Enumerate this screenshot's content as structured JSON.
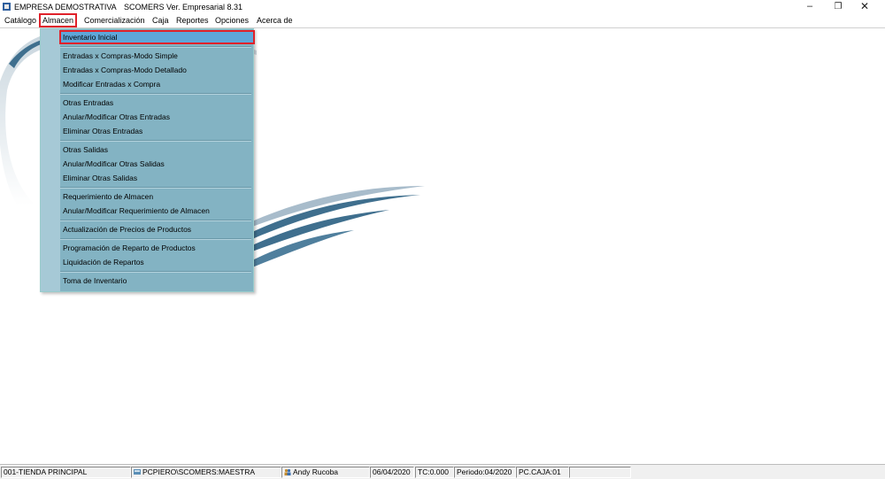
{
  "titlebar": {
    "app_name": "EMPRESA DEMOSTRATIVA",
    "version": "SCOMERS Ver. Empresarial  8.31",
    "minimize": "–",
    "restore": "❐",
    "close": "✕"
  },
  "menubar": {
    "items": [
      "Catálogo",
      "Almacen",
      "Comercialización",
      "Caja",
      "Reportes",
      "Opciones",
      "Acerca de"
    ],
    "active_item": "Almacen"
  },
  "dropdown": {
    "items": [
      "Inventario Inicial",
      "Entradas x Compras-Modo Simple",
      "Entradas x Compras-Modo Detallado",
      "Modificar Entradas x Compra",
      "Otras Entradas",
      "Anular/Modificar Otras Entradas",
      "Eliminar Otras Entradas",
      "Otras Salidas",
      "Anular/Modificar Otras Salidas",
      "Eliminar Otras Salidas",
      "Requerimiento de Almacen",
      "Anular/Modificar Requerimiento de Almacen",
      "Actualización de Precios de Productos",
      "Programación de Reparto de Productos",
      "Liquidación de Repartos",
      "Toma de Inventario"
    ],
    "selected": "Inventario Inicial"
  },
  "statusbar": {
    "store": "001-TIENDA PRINCIPAL",
    "database": "PCPIERO\\SCOMERS:MAESTRA",
    "user": "Andy Rucoba",
    "date": "06/04/2020",
    "tc": "TC:0.000",
    "period": "Periodo:04/2020",
    "register": "PC.CAJA:01"
  },
  "colors": {
    "menu_bg": "#83b3c3",
    "menu_selected": "#5fa6d9",
    "highlight": "#e0212a",
    "swoosh": "#3f6f8e"
  }
}
